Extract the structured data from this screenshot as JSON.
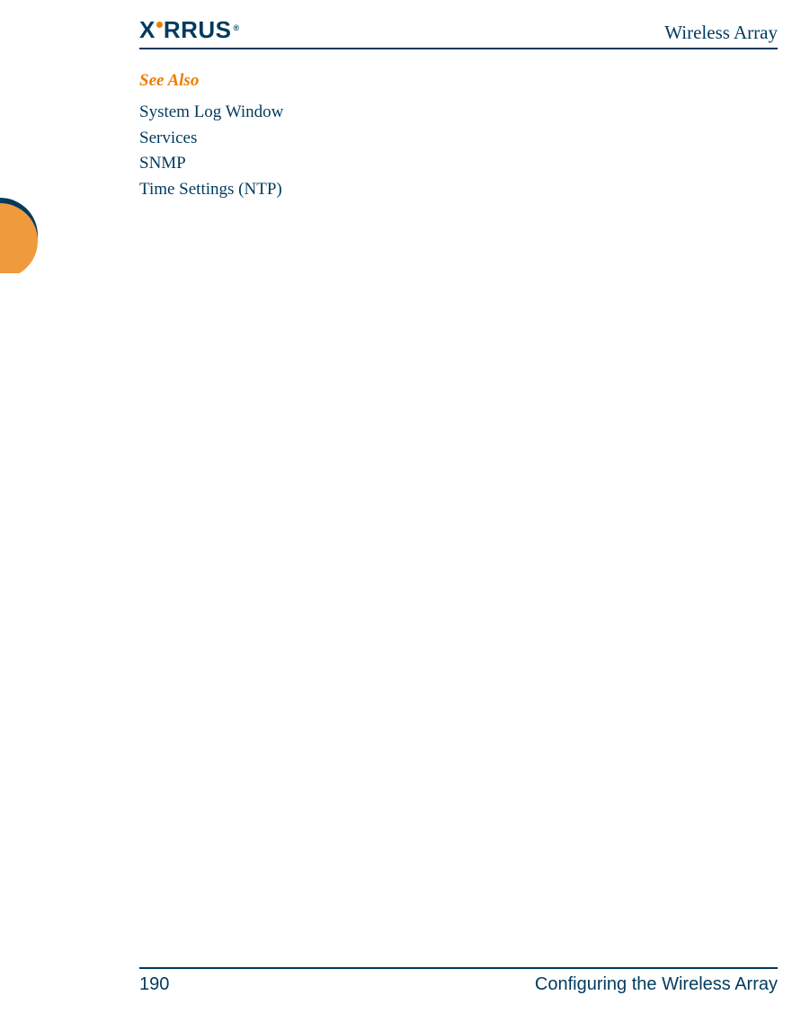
{
  "header": {
    "logo_text_1": "X",
    "logo_text_2": "RRUS",
    "document_title": "Wireless Array"
  },
  "content": {
    "see_also_heading": "See Also",
    "links": [
      "System Log Window",
      "Services",
      "SNMP",
      "Time Settings (NTP)"
    ]
  },
  "footer": {
    "page_number": "190",
    "chapter_title": "Configuring the Wireless Array"
  }
}
